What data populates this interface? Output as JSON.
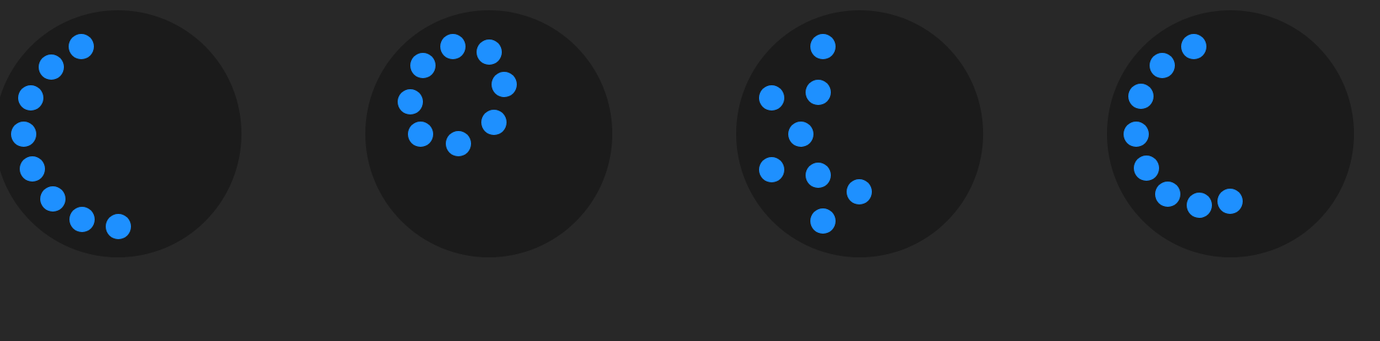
{
  "colors": {
    "background": "#282828",
    "disc": "#1b1b1b",
    "dot": "#1e90ff"
  },
  "spinners": [
    {
      "name": "loading-spinner-1",
      "dot_count": 8
    },
    {
      "name": "loading-spinner-2",
      "dot_count": 8
    },
    {
      "name": "loading-spinner-3",
      "dot_count": 8
    },
    {
      "name": "loading-spinner-4",
      "dot_count": 8
    }
  ]
}
